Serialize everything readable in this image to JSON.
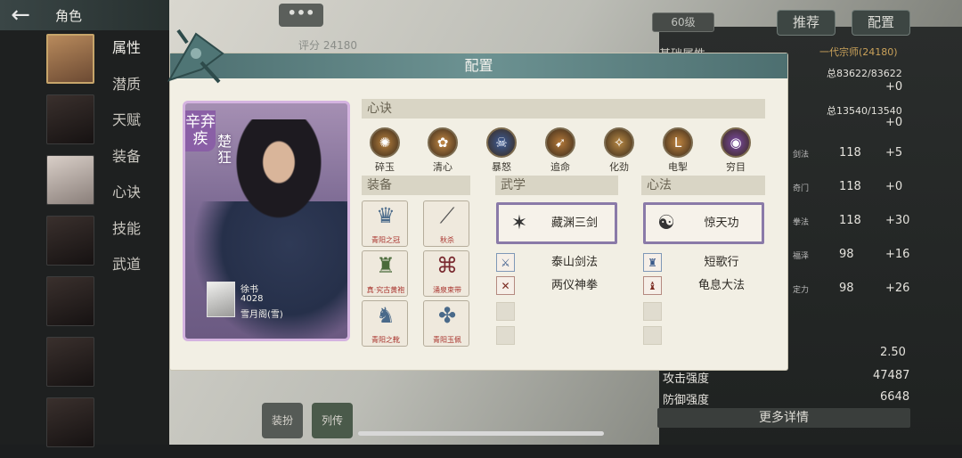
{
  "header": {
    "title": "角色",
    "chat": "•••"
  },
  "sidebar": {
    "items": [
      "属性",
      "潜质",
      "天赋",
      "装备",
      "心诀",
      "技能",
      "武道"
    ],
    "selected": 0
  },
  "background": {
    "score": "评分 24180",
    "level": "60级",
    "recommend_button": "推荐",
    "config_button": "配置",
    "stats_title": "基础属性",
    "rank": "一代宗师(24180)",
    "hp": "总83622/83622",
    "hp_delta": "+0",
    "mp": "总13540/13540",
    "mp_delta": "+0",
    "attr_rows": [
      {
        "label": "剑法",
        "value": "118",
        "delta": "+5"
      },
      {
        "label": "奇门",
        "value": "118",
        "delta": "+0"
      },
      {
        "label": "拳法",
        "value": "118",
        "delta": "+30"
      },
      {
        "label": "福泽",
        "value": "98",
        "delta": "+16"
      },
      {
        "label": "定力",
        "value": "98",
        "delta": "+26"
      }
    ],
    "extra_value": "2.50",
    "attack_label": "攻击强度",
    "attack_value": "47487",
    "defense_label": "防御强度",
    "defense_value": "6648",
    "more_button": "更多详情",
    "bottom_tab_1": "装扮",
    "bottom_tab_2": "列传"
  },
  "modal": {
    "title": "配置",
    "card": {
      "name": "辛弃疾",
      "title": "楚狂",
      "player_name": "徐书",
      "player_score": "4028",
      "player_guild": "雪月阁(雪)"
    },
    "xinjue_header": "心诀",
    "xinjue": [
      {
        "label": "碎玉",
        "color": "#b9823e",
        "glyph": "✺"
      },
      {
        "label": "清心",
        "color": "#c58a45",
        "glyph": "✿"
      },
      {
        "label": "暴怒",
        "color": "#3c5c9a",
        "glyph": "☠"
      },
      {
        "label": "追命",
        "color": "#b57a3a",
        "glyph": "➹"
      },
      {
        "label": "化劲",
        "color": "#b98a45",
        "glyph": "✧"
      },
      {
        "label": "电掣",
        "color": "#c08540",
        "glyph": "L"
      },
      {
        "label": "穷目",
        "color": "#7b4aa8",
        "glyph": "◉"
      }
    ],
    "equip_header": "装备",
    "equip": [
      {
        "label": "青阳之冠",
        "glyph": "♛"
      },
      {
        "label": "秋杀",
        "glyph": "⟋"
      },
      {
        "label": "真·究古黄袍",
        "glyph": "♜"
      },
      {
        "label": "涌泉束带",
        "glyph": "⌘"
      },
      {
        "label": "青阳之靴",
        "glyph": "♞"
      },
      {
        "label": "青阳玉佩",
        "glyph": "✤"
      }
    ],
    "wuxue_header": "武学",
    "wuxue_main": "藏渊三剑",
    "wuxue_list": [
      "泰山剑法",
      "两仪神拳"
    ],
    "xinfa_header": "心法",
    "xinfa_main": "惊天功",
    "xinfa_list": [
      "短歌行",
      "龟息大法"
    ]
  }
}
